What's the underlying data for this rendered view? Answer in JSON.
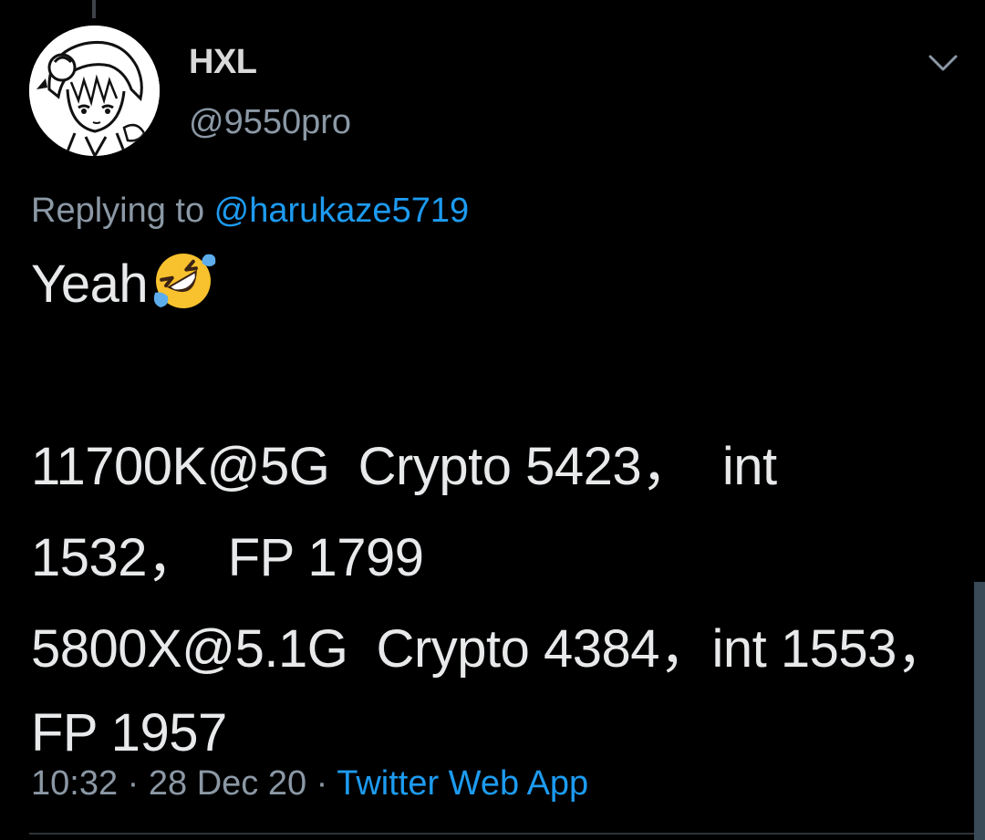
{
  "tweet": {
    "display_name": "HXL",
    "handle": "@9550pro",
    "replying_prefix": "Replying to ",
    "replying_to": "@harukaze5719",
    "lines": [
      "Yeah",
      "",
      "11700K@5G  Crypto 5423，  int",
      "1532，  FP 1799",
      "5800X@5.1G  Crypto 4384，int 1553，",
      "FP 1957"
    ],
    "emoji": "rolling-on-the-floor-laughing",
    "time": "10:32",
    "separator": " · ",
    "date": "28 Dec 20",
    "source": "Twitter Web App"
  },
  "icons": {
    "caret": "chevron-down-icon",
    "avatar": "anime-avatar"
  },
  "colors": {
    "background": "#000000",
    "text_primary": "#e7e9ea",
    "text_secondary": "#8b98a5",
    "accent": "#1d9bf0"
  }
}
